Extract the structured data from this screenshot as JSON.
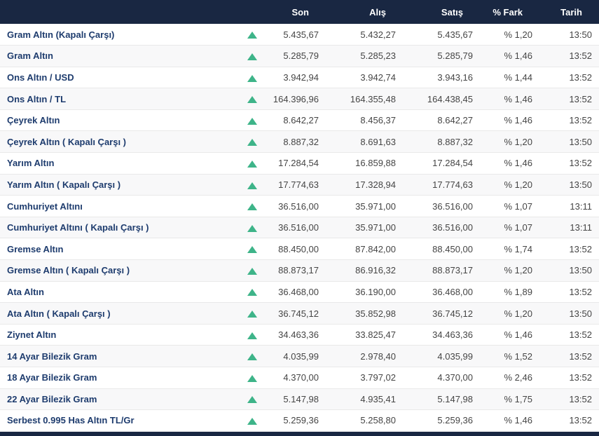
{
  "colors": {
    "header_bg": "#192742",
    "row_alt_bg": "#f8f8f9",
    "name_color": "#1e3c6e",
    "up_green": "#3eb489"
  },
  "table": {
    "headers": [
      "Son",
      "Alış",
      "Satış",
      "% Fark",
      "Tarih"
    ],
    "up_icon": "up-triangle-icon",
    "rows": [
      {
        "name": "Gram Altın (Kapalı Çarşı)",
        "direction": "up",
        "son": "5.435,67",
        "alis": "5.432,27",
        "satis": "5.435,67",
        "fark": "% 1,20",
        "tarih": "13:50"
      },
      {
        "name": "Gram Altın",
        "direction": "up",
        "son": "5.285,79",
        "alis": "5.285,23",
        "satis": "5.285,79",
        "fark": "% 1,46",
        "tarih": "13:52"
      },
      {
        "name": "Ons Altın / USD",
        "direction": "up",
        "son": "3.942,94",
        "alis": "3.942,74",
        "satis": "3.943,16",
        "fark": "% 1,44",
        "tarih": "13:52"
      },
      {
        "name": "Ons Altın / TL",
        "direction": "up",
        "son": "164.396,96",
        "alis": "164.355,48",
        "satis": "164.438,45",
        "fark": "% 1,46",
        "tarih": "13:52"
      },
      {
        "name": "Çeyrek Altın",
        "direction": "up",
        "son": "8.642,27",
        "alis": "8.456,37",
        "satis": "8.642,27",
        "fark": "% 1,46",
        "tarih": "13:52"
      },
      {
        "name": "Çeyrek Altın ( Kapalı Çarşı )",
        "direction": "up",
        "son": "8.887,32",
        "alis": "8.691,63",
        "satis": "8.887,32",
        "fark": "% 1,20",
        "tarih": "13:50"
      },
      {
        "name": "Yarım Altın",
        "direction": "up",
        "son": "17.284,54",
        "alis": "16.859,88",
        "satis": "17.284,54",
        "fark": "% 1,46",
        "tarih": "13:52"
      },
      {
        "name": "Yarım Altın ( Kapalı Çarşı )",
        "direction": "up",
        "son": "17.774,63",
        "alis": "17.328,94",
        "satis": "17.774,63",
        "fark": "% 1,20",
        "tarih": "13:50"
      },
      {
        "name": "Cumhuriyet Altını",
        "direction": "up",
        "son": "36.516,00",
        "alis": "35.971,00",
        "satis": "36.516,00",
        "fark": "% 1,07",
        "tarih": "13:11"
      },
      {
        "name": "Cumhuriyet Altını ( Kapalı Çarşı )",
        "direction": "up",
        "son": "36.516,00",
        "alis": "35.971,00",
        "satis": "36.516,00",
        "fark": "% 1,07",
        "tarih": "13:11"
      },
      {
        "name": "Gremse Altın",
        "direction": "up",
        "son": "88.450,00",
        "alis": "87.842,00",
        "satis": "88.450,00",
        "fark": "% 1,74",
        "tarih": "13:52"
      },
      {
        "name": "Gremse Altın ( Kapalı Çarşı )",
        "direction": "up",
        "son": "88.873,17",
        "alis": "86.916,32",
        "satis": "88.873,17",
        "fark": "% 1,20",
        "tarih": "13:50"
      },
      {
        "name": "Ata Altın",
        "direction": "up",
        "son": "36.468,00",
        "alis": "36.190,00",
        "satis": "36.468,00",
        "fark": "% 1,89",
        "tarih": "13:52"
      },
      {
        "name": "Ata Altın ( Kapalı Çarşı )",
        "direction": "up",
        "son": "36.745,12",
        "alis": "35.852,98",
        "satis": "36.745,12",
        "fark": "% 1,20",
        "tarih": "13:50"
      },
      {
        "name": "Ziynet Altın",
        "direction": "up",
        "son": "34.463,36",
        "alis": "33.825,47",
        "satis": "34.463,36",
        "fark": "% 1,46",
        "tarih": "13:52"
      },
      {
        "name": "14 Ayar Bilezik Gram",
        "direction": "up",
        "son": "4.035,99",
        "alis": "2.978,40",
        "satis": "4.035,99",
        "fark": "% 1,52",
        "tarih": "13:52"
      },
      {
        "name": "18 Ayar Bilezik Gram",
        "direction": "up",
        "son": "4.370,00",
        "alis": "3.797,02",
        "satis": "4.370,00",
        "fark": "% 2,46",
        "tarih": "13:52"
      },
      {
        "name": "22 Ayar Bilezik Gram",
        "direction": "up",
        "son": "5.147,98",
        "alis": "4.935,41",
        "satis": "5.147,98",
        "fark": "% 1,75",
        "tarih": "13:52"
      },
      {
        "name": "Serbest 0.995 Has Altın TL/Gr",
        "direction": "up",
        "son": "5.259,36",
        "alis": "5.258,80",
        "satis": "5.259,36",
        "fark": "% 1,46",
        "tarih": "13:52"
      }
    ]
  }
}
